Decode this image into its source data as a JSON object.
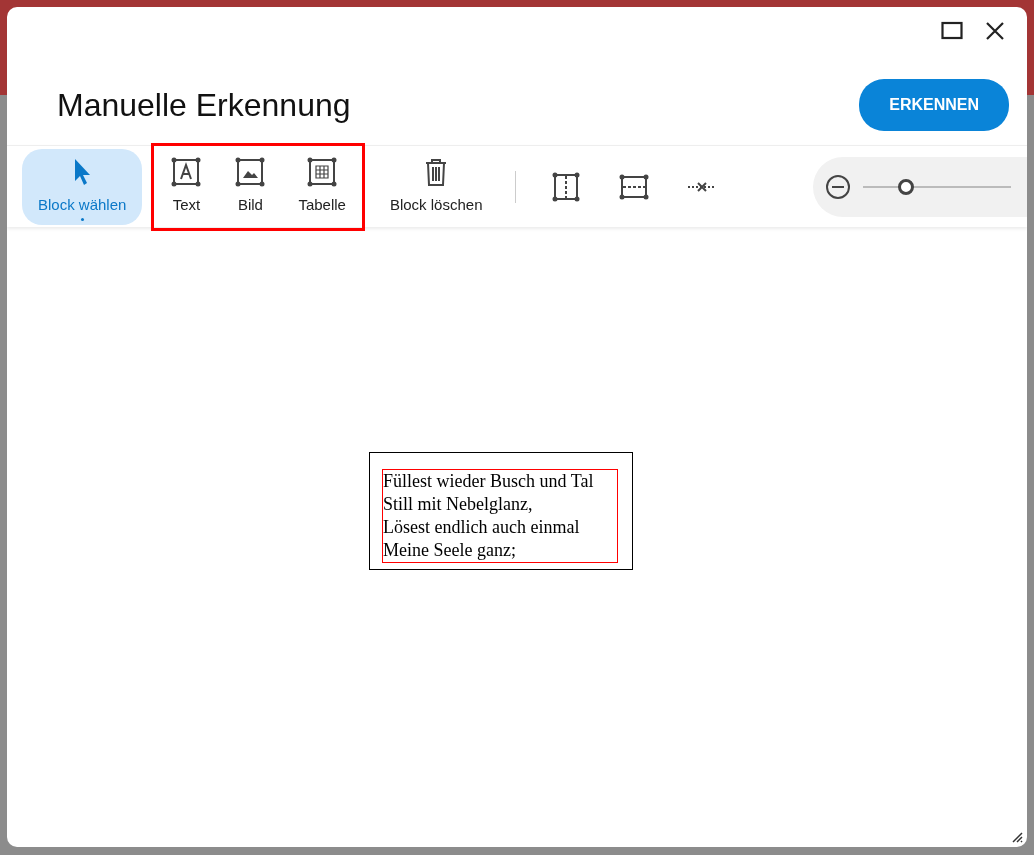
{
  "dialog": {
    "title": "Manuelle Erkennung",
    "primary_button": "ERKENNEN"
  },
  "toolbar": {
    "groups": [
      {
        "highlighted": false,
        "tools": [
          {
            "kind": "select",
            "label": "Block wählen",
            "selected": true
          }
        ]
      },
      {
        "highlighted": true,
        "tools": [
          {
            "kind": "text",
            "label": "Text",
            "selected": false
          },
          {
            "kind": "image",
            "label": "Bild",
            "selected": false
          },
          {
            "kind": "table",
            "label": "Tabelle",
            "selected": false
          }
        ]
      },
      {
        "highlighted": false,
        "tools": [
          {
            "kind": "delete",
            "label": "Block löschen",
            "selected": false
          }
        ]
      },
      {
        "highlighted": false,
        "tools": [
          {
            "kind": "split-vertical",
            "selected": false
          },
          {
            "kind": "split-horizontal",
            "selected": false
          },
          {
            "kind": "merge",
            "selected": false
          }
        ]
      }
    ],
    "zoom": {
      "level": 0.29
    }
  },
  "canvas": {
    "block_lines": [
      "Füllest wieder Busch und Tal",
      "Still mit Nebelglanz,",
      "Lösest endlich auch einmal",
      "Meine Seele ganz;"
    ]
  }
}
